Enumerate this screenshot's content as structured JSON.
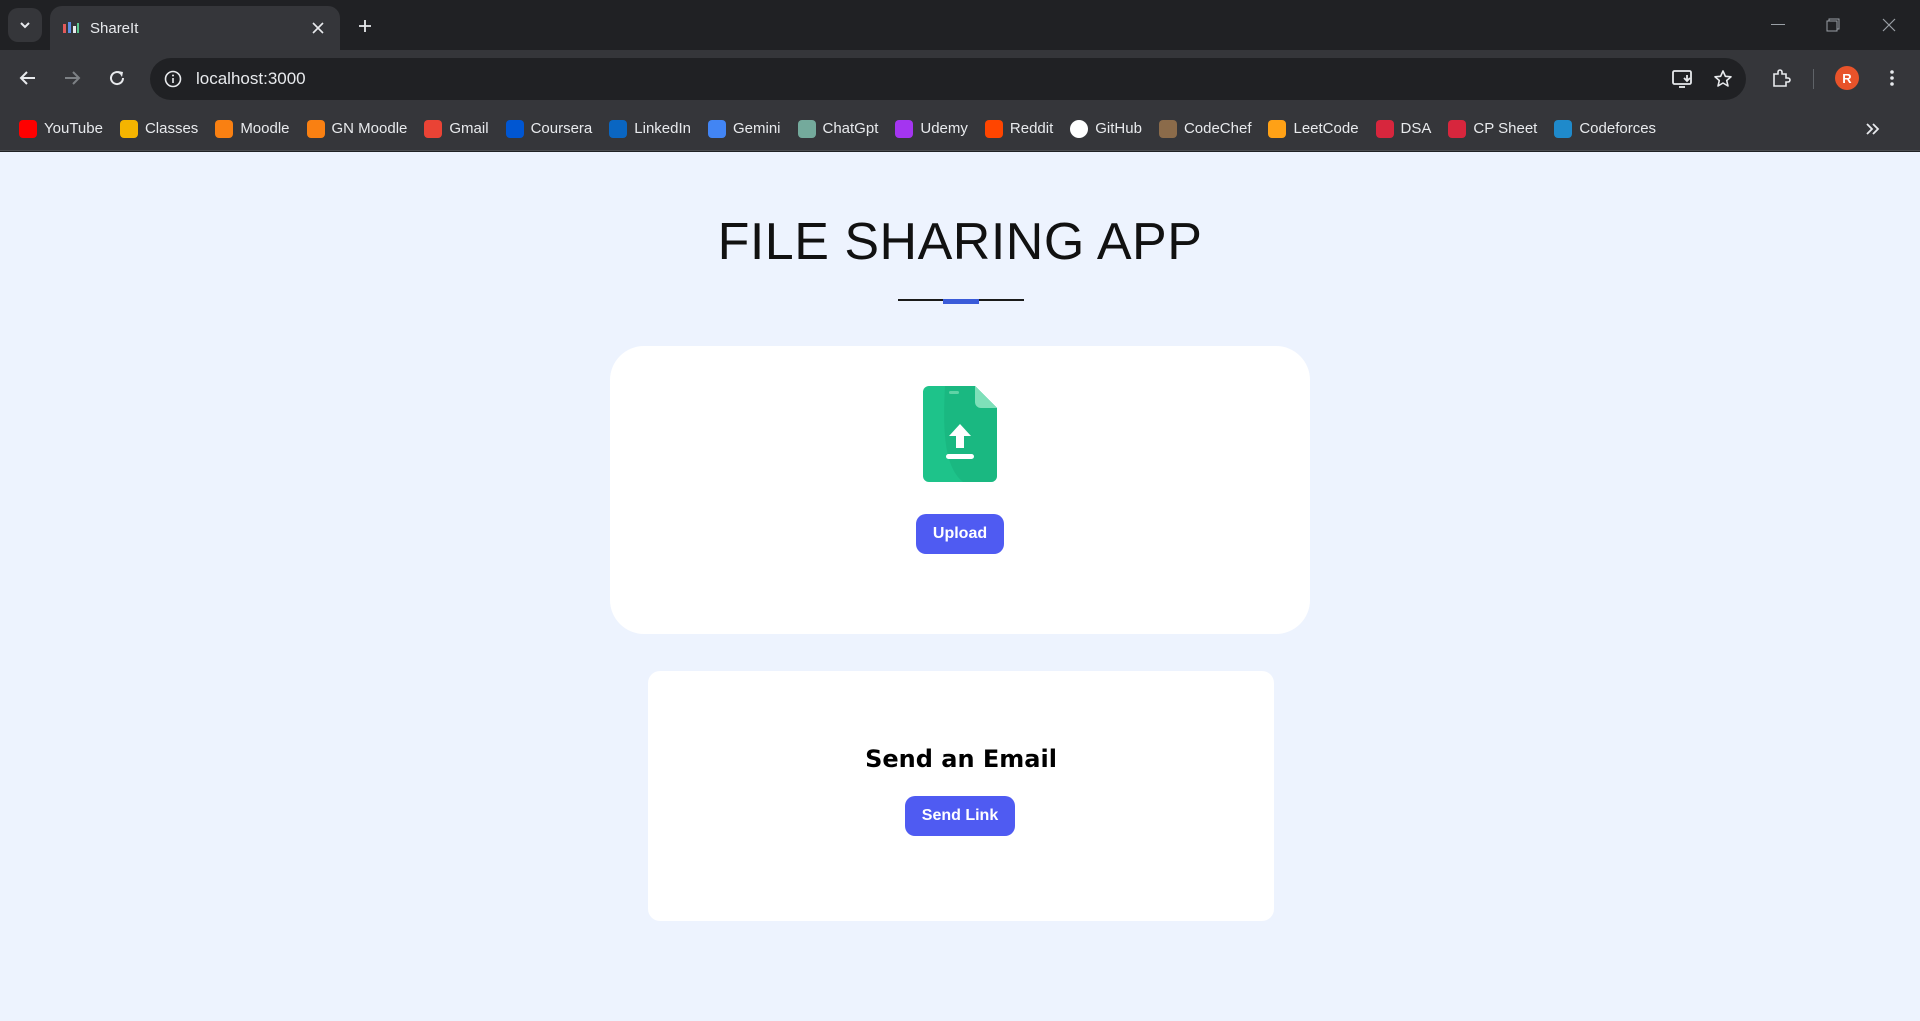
{
  "browser": {
    "tab_title": "ShareIt",
    "url": "localhost:3000",
    "profile_initial": "R",
    "bookmarks": [
      {
        "label": "YouTube",
        "icon": "youtube-icon",
        "color": "#ff0000"
      },
      {
        "label": "Classes",
        "icon": "classroom-icon",
        "color": "#f4b400"
      },
      {
        "label": "Moodle",
        "icon": "moodle-icon",
        "color": "#f98012"
      },
      {
        "label": "GN Moodle",
        "icon": "moodle-icon",
        "color": "#f98012"
      },
      {
        "label": "Gmail",
        "icon": "gmail-icon",
        "color": "#ea4335"
      },
      {
        "label": "Coursera",
        "icon": "coursera-icon",
        "color": "#0056d2"
      },
      {
        "label": "LinkedIn",
        "icon": "linkedin-icon",
        "color": "#0a66c2"
      },
      {
        "label": "Gemini",
        "icon": "gemini-icon",
        "color": "#4285f4"
      },
      {
        "label": "ChatGpt",
        "icon": "chatgpt-icon",
        "color": "#74aa9c"
      },
      {
        "label": "Udemy",
        "icon": "udemy-icon",
        "color": "#a435f0"
      },
      {
        "label": "Reddit",
        "icon": "reddit-icon",
        "color": "#ff4500"
      },
      {
        "label": "GitHub",
        "icon": "github-icon",
        "color": "#ffffff"
      },
      {
        "label": "CodeChef",
        "icon": "codechef-icon",
        "color": "#8b6b4a"
      },
      {
        "label": "LeetCode",
        "icon": "leetcode-icon",
        "color": "#ffa116"
      },
      {
        "label": "DSA",
        "icon": "tuf-icon",
        "color": "#d7263d"
      },
      {
        "label": "CP Sheet",
        "icon": "tuf-icon",
        "color": "#d7263d"
      },
      {
        "label": "Codeforces",
        "icon": "codeforces-icon",
        "color": "#1f8acb"
      }
    ]
  },
  "page": {
    "title": "FILE SHARING APP",
    "upload_button": "Upload",
    "email_title": "Send an Email",
    "send_button": "Send Link"
  },
  "colors": {
    "accent": "#4f5bf2",
    "page_bg": "#edf3fe",
    "upload_icon": "#1ec38a"
  }
}
